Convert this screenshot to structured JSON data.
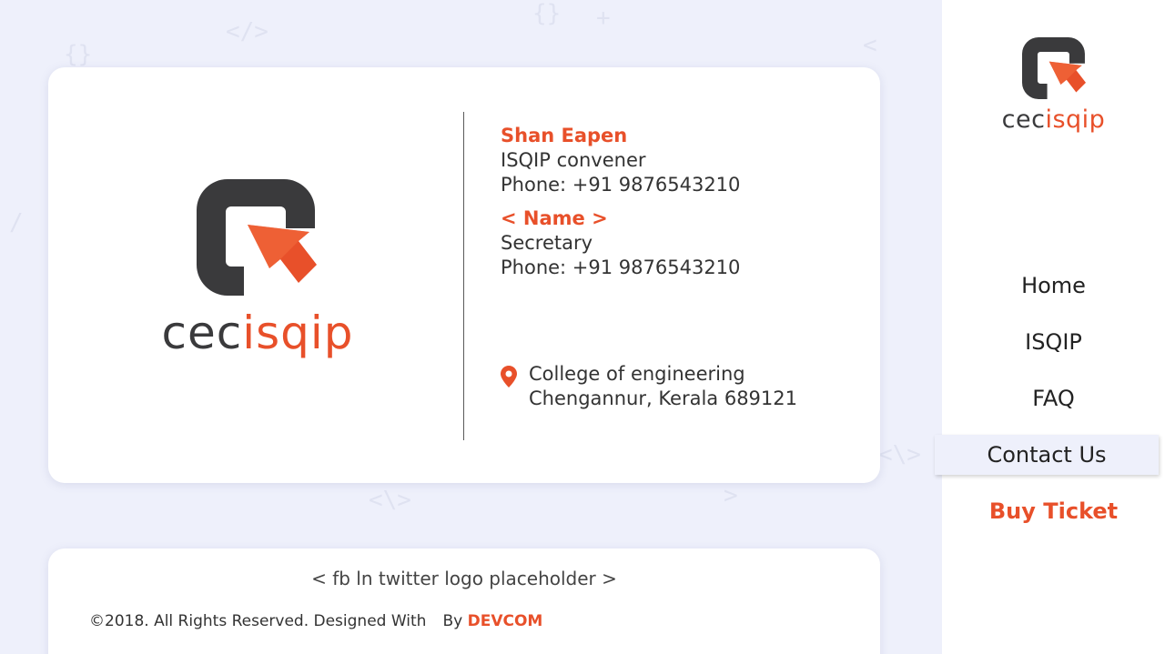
{
  "colors": {
    "accent": "#e8502a",
    "dark": "#3a3a3c",
    "background": "#eef0fb",
    "card": "#ffffff"
  },
  "logo": {
    "word_dark": "cec",
    "word_accent": "isqip"
  },
  "contacts": [
    {
      "name": "Shan Eapen",
      "role": "ISQIP convener",
      "phone": "Phone: +91 9876543210"
    },
    {
      "name": "< Name >",
      "role": "Secretary",
      "phone": "Phone: +91 9876543210"
    }
  ],
  "address": {
    "icon": "location-pin-icon",
    "line1": "College of engineering",
    "line2": "Chengannur, Kerala 689121"
  },
  "footer": {
    "social_placeholder": "< fb ln twitter logo placeholder >",
    "copyright_prefix": "©2018. All Rights Reserved. Designed With",
    "copyright_by": "By",
    "brand": "DEVCOM"
  },
  "nav": {
    "items": [
      {
        "label": "Home"
      },
      {
        "label": "ISQIP"
      },
      {
        "label": "FAQ"
      },
      {
        "label": "Contact Us",
        "active": true
      },
      {
        "label": "Buy Ticket",
        "highlight": true
      }
    ]
  }
}
